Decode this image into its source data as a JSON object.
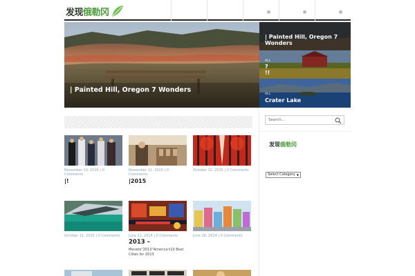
{
  "header": {
    "logo_text": "发现",
    "logo_text_green": "俄勒冈",
    "nav_count": 5
  },
  "hero": {
    "main_caption": "|  Painted Hill, Oregon 7 Wonders",
    "slides": [
      {
        "tag": "",
        "title": "|  Painted Hill, Oregon 7 Wonders"
      },
      {
        "tag": "ALL",
        "title": "?\n!!"
      },
      {
        "tag": "ALL",
        "title": "Crater Lake"
      }
    ]
  },
  "posts": [
    {
      "meta": "November 13, 2015 | 0 Comments",
      "title": "|!",
      "excerpt": ""
    },
    {
      "meta": "November 12, 2015 | 0 Comments",
      "title": "|2015",
      "excerpt": ""
    },
    {
      "meta": "October 12, 2015 | 0 Comments",
      "title": "",
      "excerpt": ""
    },
    {
      "meta": "October 11, 2015 | 0 Comments",
      "title": "",
      "excerpt": ""
    },
    {
      "meta": "June 21, 2014 | 0 Comments",
      "title": "2013 –",
      "excerpt": "Moveto\"2013\"America's10 Best Cities for 2013"
    },
    {
      "meta": "June 18, 2014 | 0 Comments",
      "title": "",
      "excerpt": ""
    }
  ],
  "sidebar": {
    "search_placeholder": "Search...",
    "logo_text": "发现",
    "logo_text_green": "俄勒冈",
    "category_label": "Select Category"
  }
}
